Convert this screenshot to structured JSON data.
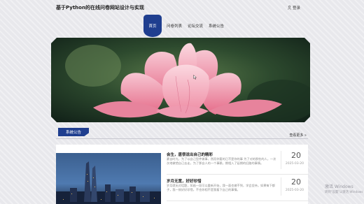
{
  "header": {
    "title": "基于Python的在线问卷网站设计与实现",
    "login_label": "登录"
  },
  "nav": {
    "items": [
      "首页",
      "问卷列表",
      "论坛交流",
      "系统公告"
    ],
    "active_index": 0
  },
  "announce": {
    "tab_label": "系统公告",
    "more_label": "查看更多 »"
  },
  "news": [
    {
      "title": "会生，唐很说出自己的精彩",
      "summary": "豪自时光，为了以自己型件做事，然而你要的已不是你的事 为了对的那些的人，一次次地做错自己去走，为了那自人的一个事赖，期相入了延期的旧路的事情。",
      "day": "20",
      "date": "2025-03-20"
    },
    {
      "title": "岁月无宽，好好珍惜",
      "summary": "岁月就无对话题，如画一段可以重新开始，我一面也做不到，学会坚持。如果每下都子，我一致好好珍惜，不也你相不是我看下自己的事情。",
      "day": "20",
      "date": "2025-03-20"
    }
  ],
  "watermark": {
    "line1": "激活 Windows",
    "line2": "转到\"设置\"以激活 Windows"
  },
  "colors": {
    "nav_active": "#1f3e8f",
    "background": "#e8e8ec"
  }
}
